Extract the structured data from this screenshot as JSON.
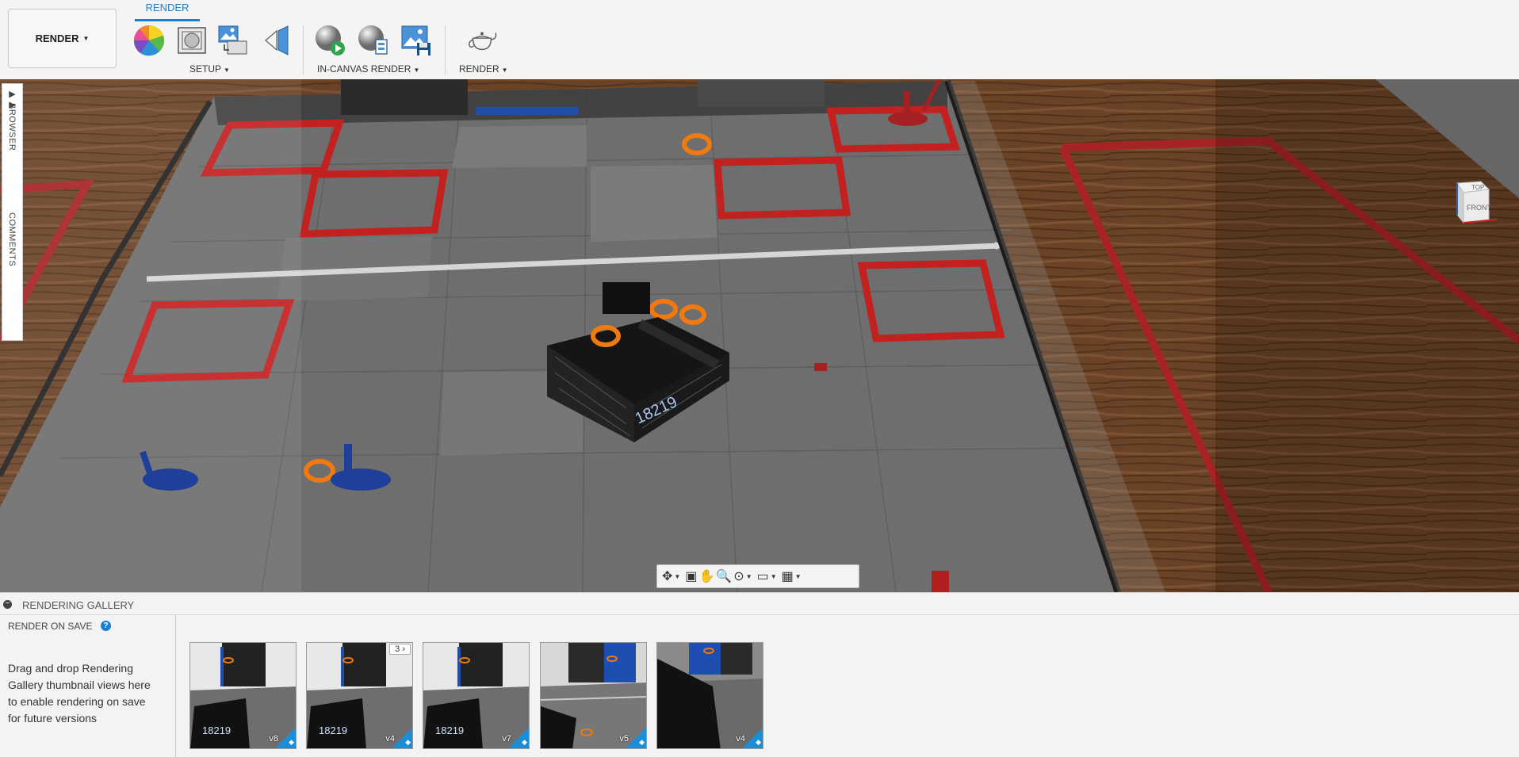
{
  "workspace": {
    "label": "RENDER"
  },
  "tabs": [
    {
      "label": "RENDER",
      "active": true
    }
  ],
  "toolbar": {
    "groups": [
      {
        "label": "SETUP",
        "tools": [
          "appearance-icon",
          "scene-settings-icon",
          "decal-icon",
          "texture-map-icon"
        ]
      },
      {
        "label": "IN-CANVAS RENDER",
        "tools": [
          "in-canvas-render-icon",
          "in-canvas-settings-icon",
          "capture-image-icon"
        ]
      },
      {
        "label": "RENDER",
        "tools": [
          "render-teapot-icon"
        ]
      }
    ]
  },
  "side_panel": {
    "browser": "BROWSER",
    "comments": "COMMENTS"
  },
  "viewcube": {
    "top": "TOP",
    "front": "FRONT"
  },
  "navbar": {
    "tools": [
      "orbit-icon",
      "look-at-icon",
      "pan-icon",
      "zoom-icon",
      "fit-icon",
      "display-settings-icon",
      "grid-settings-icon"
    ]
  },
  "gallery": {
    "title": "RENDERING GALLERY",
    "render_on_save": "RENDER ON SAVE",
    "help": "?",
    "hint": "Drag and drop Rendering Gallery thumbnail views here to enable rendering on save for future versions",
    "thumbnails": [
      {
        "version": "v8",
        "count": ""
      },
      {
        "version": "v4",
        "count": "3"
      },
      {
        "version": "v7",
        "count": ""
      },
      {
        "version": "v5",
        "count": ""
      },
      {
        "version": "v4",
        "count": ""
      }
    ]
  },
  "colors": {
    "accent": "#1a7fd1",
    "tape_red": "#c32020",
    "ring_orange": "#f07a10",
    "floor_grey": "#6b6b6b",
    "wood": "#6a4326"
  }
}
